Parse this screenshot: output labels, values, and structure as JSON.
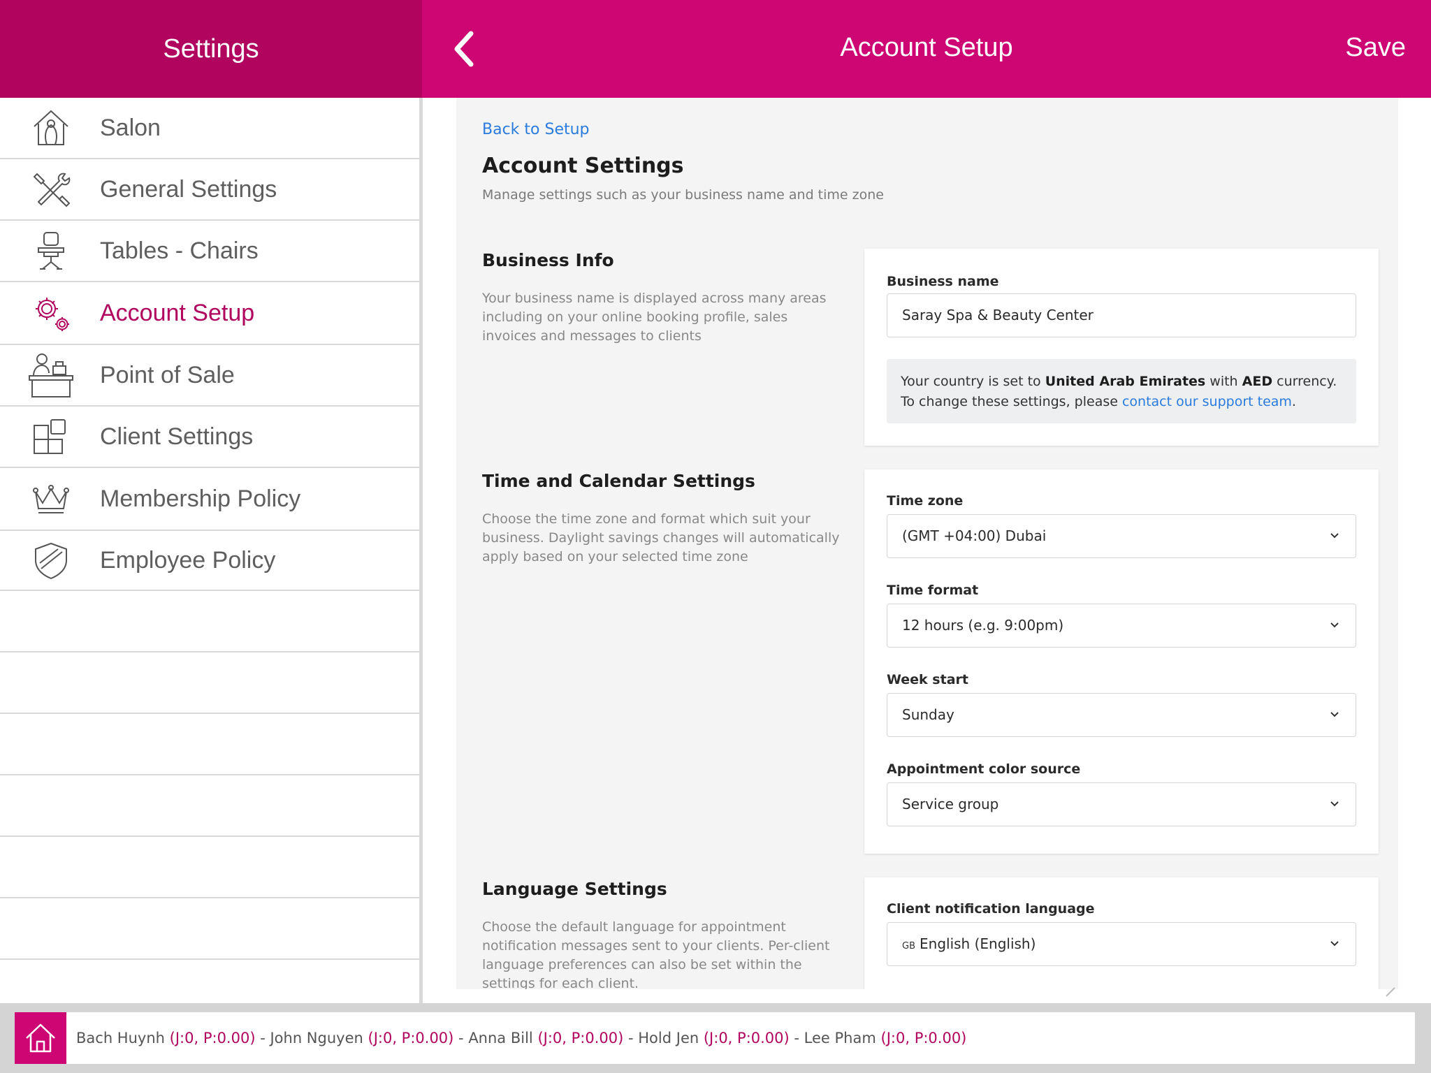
{
  "left_header": {
    "title": "Settings"
  },
  "right_header": {
    "title": "Account Setup",
    "save_label": "Save",
    "back_icon": "chevron-left-icon"
  },
  "sidebar": {
    "items": [
      {
        "label": "Salon",
        "icon": "salon-house-icon"
      },
      {
        "label": "General Settings",
        "icon": "tools-icon"
      },
      {
        "label": "Tables - Chairs",
        "icon": "salon-chair-icon"
      },
      {
        "label": "Account Setup",
        "icon": "gears-icon",
        "active": true
      },
      {
        "label": "Point of Sale",
        "icon": "cashier-desk-icon"
      },
      {
        "label": "Client Settings",
        "icon": "blocks-icon"
      },
      {
        "label": "Membership Policy",
        "icon": "crown-icon"
      },
      {
        "label": "Employee Policy",
        "icon": "shield-icon"
      }
    ]
  },
  "main": {
    "back_link": "Back to Setup",
    "title": "Account Settings",
    "subtitle": "Manage settings such as your business name and time zone",
    "business_info": {
      "title": "Business Info",
      "description": "Your business name is displayed across many areas including on your online booking profile, sales invoices and messages to clients",
      "name_label": "Business name",
      "name_value": "Saray Spa & Beauty Center",
      "notice": {
        "prefix": "Your country is set to ",
        "country": "United Arab Emirates",
        "middle": " with ",
        "currency": "AED",
        "suffix": " currency. To change these settings, please ",
        "link": "contact our support team",
        "end": "."
      }
    },
    "time_calendar": {
      "title": "Time and Calendar Settings",
      "description": "Choose the time zone and format which suit your business. Daylight savings changes will automatically apply based on your selected time zone",
      "timezone_label": "Time zone",
      "timezone_value": "(GMT +04:00) Dubai",
      "format_label": "Time format",
      "format_value": "12 hours (e.g. 9:00pm)",
      "week_label": "Week start",
      "week_value": "Sunday",
      "color_label": "Appointment color source",
      "color_value": "Service group"
    },
    "language": {
      "title": "Language Settings",
      "description": "Choose the default language for appointment notification messages sent to your clients. Per-client language preferences can also be set within the settings for each client.",
      "notif_label": "Client notification language",
      "notif_flag": "GB",
      "notif_value": "English (English)"
    }
  },
  "footer": {
    "staff": [
      {
        "name": "Bach Huynh",
        "stat": "(J:0, P:0.00)"
      },
      {
        "name": "John Nguyen",
        "stat": "(J:0, P:0.00)"
      },
      {
        "name": "Anna Bill",
        "stat": "(J:0, P:0.00)"
      },
      {
        "name": "Hold Jen",
        "stat": "(J:0, P:0.00)"
      },
      {
        "name": "Lee Pham",
        "stat": "(J:0, P:0.00)"
      }
    ],
    "separator": " - "
  },
  "colors": {
    "brand_dark": "#b0045e",
    "brand": "#cd0674",
    "link": "#2a7bde"
  }
}
